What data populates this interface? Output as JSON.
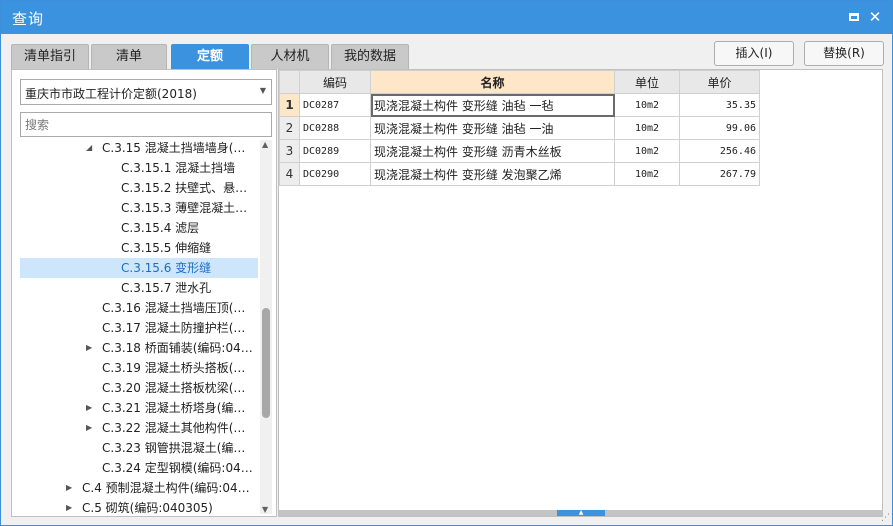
{
  "window": {
    "title": "查询"
  },
  "tabs": [
    {
      "label": "清单指引"
    },
    {
      "label": "清单"
    },
    {
      "label": "定额"
    },
    {
      "label": "人材机"
    },
    {
      "label": "我的数据"
    }
  ],
  "actions": {
    "insert_label": "插入(I)",
    "replace_label": "替换(R)"
  },
  "library": {
    "selected": "重庆市市政工程计价定额(2018)"
  },
  "search": {
    "placeholder": "搜索"
  },
  "tree": [
    {
      "label": "C.3.15 混凝土挡墙墙身(…",
      "expanded": true
    },
    {
      "label": "C.3.15.1 混凝土挡墙"
    },
    {
      "label": "C.3.15.2 扶壁式、悬…"
    },
    {
      "label": "C.3.15.3 薄壁混凝土…"
    },
    {
      "label": "C.3.15.4 滤层"
    },
    {
      "label": "C.3.15.5 伸缩缝"
    },
    {
      "label": "C.3.15.6 变形缝",
      "selected": true
    },
    {
      "label": "C.3.15.7 泄水孔"
    },
    {
      "label": "C.3.16 混凝土挡墙压顶(…"
    },
    {
      "label": "C.3.17 混凝土防撞护栏(…"
    },
    {
      "label": "C.3.18 桥面铺装(编码:04…",
      "collapsed": true
    },
    {
      "label": "C.3.19 混凝土桥头搭板(…"
    },
    {
      "label": "C.3.20 混凝土搭板枕梁(…"
    },
    {
      "label": "C.3.21 混凝土桥塔身(编…",
      "collapsed": true
    },
    {
      "label": "C.3.22 混凝土其他构件(…",
      "collapsed": true
    },
    {
      "label": "C.3.23 钢管拱混凝土(编…"
    },
    {
      "label": "C.3.24 定型钢模(编码:04…"
    },
    {
      "label": "C.4 预制混凝土构件(编码:04…",
      "collapsed": true
    },
    {
      "label": "C.5 砌筑(编码:040305)",
      "collapsed": true
    }
  ],
  "grid": {
    "headers": {
      "code": "编码",
      "name": "名称",
      "unit": "单位",
      "price": "单价"
    },
    "rows": [
      {
        "num": "1",
        "code": "DC0287",
        "name": "现浇混凝土构件 变形缝 油毡 一毡",
        "unit": "10m2",
        "price": "35.35"
      },
      {
        "num": "2",
        "code": "DC0288",
        "name": "现浇混凝土构件 变形缝 油毡 一油",
        "unit": "10m2",
        "price": "99.06"
      },
      {
        "num": "3",
        "code": "DC0289",
        "name": "现浇混凝土构件 变形缝 沥青木丝板",
        "unit": "10m2",
        "price": "256.46"
      },
      {
        "num": "4",
        "code": "DC0290",
        "name": "现浇混凝土构件 变形缝 发泡聚乙烯",
        "unit": "10m2",
        "price": "267.79"
      }
    ]
  },
  "colors": {
    "accent": "#3b93e0",
    "selection": "#cde6fb",
    "header_highlight": "#fde7c8"
  }
}
